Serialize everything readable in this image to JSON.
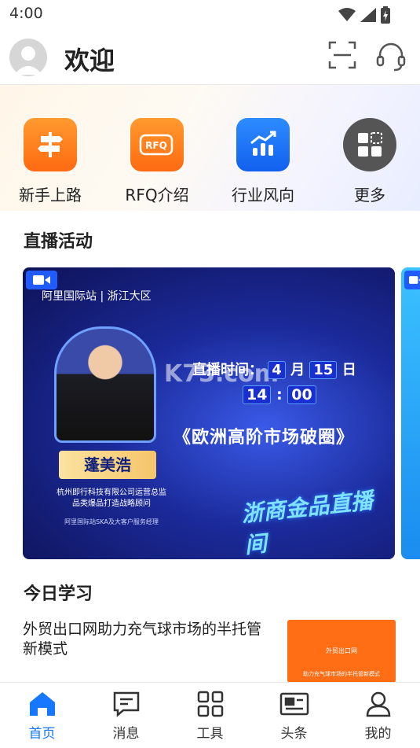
{
  "status_bar": {
    "time": "4:00"
  },
  "header": {
    "title": "欢迎"
  },
  "shortcuts": [
    {
      "label": "新手上路",
      "icon": "signpost-icon",
      "color": "#ff7a1a"
    },
    {
      "label": "RFQ介绍",
      "icon": "rfq-icon",
      "color": "#ff7a1a"
    },
    {
      "label": "行业风向",
      "icon": "bar-chart-trend-icon",
      "color": "#1677ff"
    },
    {
      "label": "更多",
      "icon": "grid-more-icon",
      "color": "#555555"
    }
  ],
  "live": {
    "section_title": "直播活动",
    "banner": {
      "brand": "阿里国际站 | 浙江大区",
      "time_prefix": "直播时间：",
      "month": "4",
      "month_unit": "月",
      "day": "15",
      "day_unit": "日",
      "clock_hour": "14",
      "clock_min": "00",
      "headline": "《欧洲高阶市场破圈》",
      "speaker_name": "蓬美浩",
      "company_line1": "杭州即行科技有限公司运营总监",
      "company_line2": "品类爆品打造战略顾问",
      "company_line3": "阿里国际站SKA及大客户服务经理",
      "slogan": "浙商金品直播间",
      "watermark": "K73.com"
    }
  },
  "study": {
    "section_title": "今日学习",
    "article_title": "外贸出口网助力充气球市场的半托管新模式",
    "thumb_line1": "外贸出口网",
    "thumb_line2": "助力充气球市场的半托管新模式"
  },
  "bottom_nav": [
    {
      "label": "首页",
      "icon": "home-icon",
      "active": true
    },
    {
      "label": "消息",
      "icon": "message-icon",
      "active": false
    },
    {
      "label": "工具",
      "icon": "tools-grid-icon",
      "active": false
    },
    {
      "label": "头条",
      "icon": "news-icon",
      "active": false
    },
    {
      "label": "我的",
      "icon": "profile-icon",
      "active": false
    }
  ],
  "colors": {
    "accent": "#1677ff",
    "orange": "#ff7a1a"
  }
}
